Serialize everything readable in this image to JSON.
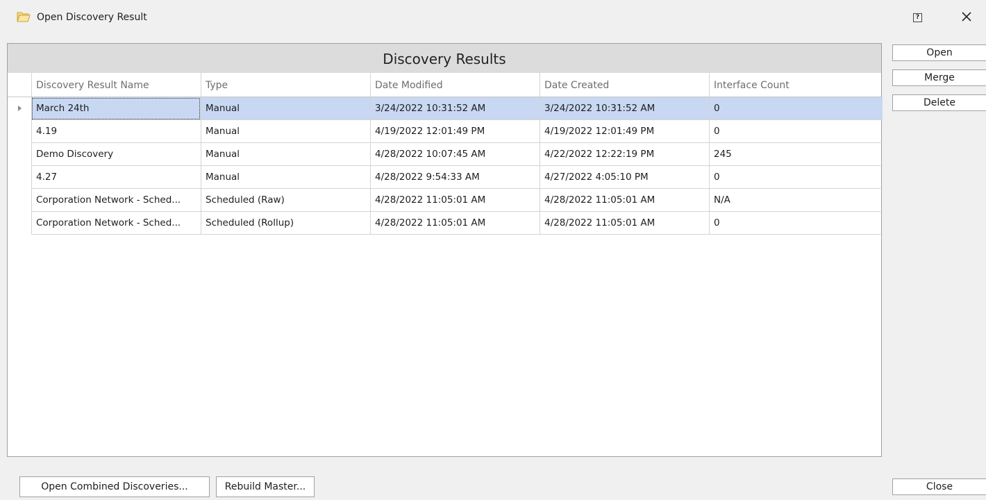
{
  "window": {
    "title": "Open Discovery Result",
    "help_label": "?",
    "title_icon": "folder-open-icon",
    "close_icon": "close-icon"
  },
  "grid": {
    "group_title": "Discovery Results",
    "columns": [
      "Discovery Result Name",
      "Type",
      "Date Modified",
      "Date Created",
      "Interface Count"
    ],
    "rows": [
      [
        "March 24th",
        "Manual",
        "3/24/2022 10:31:52 AM",
        "3/24/2022 10:31:52 AM",
        "0"
      ],
      [
        "4.19",
        "Manual",
        "4/19/2022 12:01:49 PM",
        "4/19/2022 12:01:49 PM",
        "0"
      ],
      [
        "Demo Discovery",
        "Manual",
        "4/28/2022 10:07:45 AM",
        "4/22/2022 12:22:19 PM",
        "245"
      ],
      [
        "4.27",
        "Manual",
        "4/28/2022 9:54:33 AM",
        "4/27/2022 4:05:10 PM",
        "0"
      ],
      [
        "Corporation Network - Sched...",
        "Scheduled (Raw)",
        "4/28/2022 11:05:01 AM",
        "4/28/2022 11:05:01 AM",
        "N/A"
      ],
      [
        "Corporation Network - Sched...",
        "Scheduled (Rollup)",
        "4/28/2022 11:05:01 AM",
        "4/28/2022 11:05:01 AM",
        "0"
      ]
    ],
    "selected_row": 0,
    "selection_color": "#c8d8f2"
  },
  "side_buttons": {
    "open": "Open",
    "merge": "Merge",
    "delete": "Delete",
    "close": "Close"
  },
  "bottom_buttons": {
    "open_combined": "Open Combined Discoveries...",
    "rebuild_master": "Rebuild Master..."
  }
}
